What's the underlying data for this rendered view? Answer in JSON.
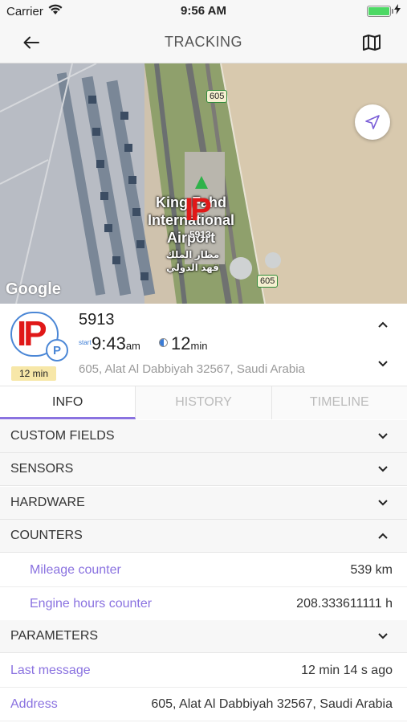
{
  "status": {
    "carrier": "Carrier",
    "time": "9:56 AM"
  },
  "nav": {
    "title": "TRACKING",
    "back_icon": "arrow-left-icon",
    "map_icon": "map-icon"
  },
  "map": {
    "airport_label": "King Fahd International Airport",
    "airport_label_line1": "King Fahd",
    "airport_label_line2": "International",
    "airport_label_line3": "Airport",
    "arabic_line1": "مطار الملك",
    "arabic_line2": "فهد الدولي",
    "unit_marker_label": "5913",
    "road_badge_1": "605",
    "road_badge_2": "605",
    "google": "Google"
  },
  "unit": {
    "name": "5913",
    "icon_text": "IP",
    "badge_text": "P",
    "age": "12 min",
    "start_label": "start",
    "start_time": "9:43",
    "start_suffix": "am",
    "duration": "12",
    "duration_suffix": "min",
    "address": "605, Alat Al Dabbiyah 32567, Saudi Arabia"
  },
  "tabs": [
    {
      "label": "INFO",
      "active": true
    },
    {
      "label": "HISTORY",
      "active": false
    },
    {
      "label": "TIMELINE",
      "active": false
    }
  ],
  "sections": {
    "custom_fields": "CUSTOM FIELDS",
    "sensors": "SENSORS",
    "hardware": "HARDWARE",
    "counters": "COUNTERS",
    "parameters": "PARAMETERS"
  },
  "counters": [
    {
      "label": "Mileage counter",
      "value": "539 km"
    },
    {
      "label": "Engine hours counter",
      "value": "208.333611111 h"
    }
  ],
  "info_rows": [
    {
      "label": "Last message",
      "value": "12 min 14 s ago"
    },
    {
      "label": "Address",
      "value": "605, Alat Al Dabbiyah 32567, Saudi Arabia"
    }
  ],
  "colors": {
    "accent": "#8a72e0",
    "link_blue": "#3a7bd5",
    "age_badge": "#f7e7a8",
    "icon_red": "#e01818"
  }
}
